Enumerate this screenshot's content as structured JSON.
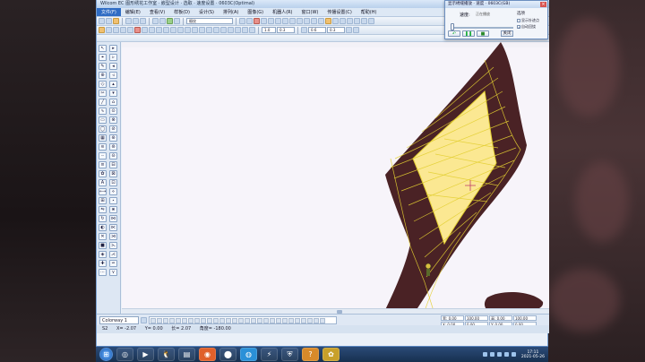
{
  "window": {
    "title": "Wilcom EC 图形绣花工作室 · 嵌型设计 · 选取 · 速度设置 · 0603C(Optimal)"
  },
  "menu": [
    "文件(F)",
    "编辑(E)",
    "查看(V)",
    "样板(D)",
    "设计(S)",
    "排列(A)",
    "图像(G)",
    "机器人(R)",
    "窗口(W)",
    "传播设置(C)",
    "帮助(H)"
  ],
  "toolbar": {
    "stitch_type_select": "缎纹",
    "value_a": "1.0",
    "value_b": "0.3",
    "value_c": "0.6",
    "value_d": "0.3"
  },
  "bottom": {
    "colorway_select": "Colorway 1"
  },
  "coords": {
    "w_label": "宽: 0.00",
    "w_val": "100.00",
    "h_label": "高: 0.00",
    "h_val": "100.00",
    "x_label": "X: 0.00",
    "x_val": "0.00",
    "y_label": "Y: 0.00",
    "y_val": "0.00"
  },
  "status": {
    "stitch": "S2",
    "coord_x": "X= -2.07",
    "coord_y": "Y= 0.00",
    "length": "长= 2.07",
    "angle": "角度= -180.00"
  },
  "dialog": {
    "title": "显示绣缝播放 · 速度 · 0603C(GB)",
    "speed_label": "速度:",
    "speed_value": "正在播放",
    "options_label": "选项",
    "opt_a": "显示针迹点",
    "opt_b": "自动回绕",
    "close_label": "关闭",
    "opt_b_checked": true
  },
  "taskbar": {
    "clock_time": "17:11",
    "clock_date": "2021-05-26"
  },
  "colors": {
    "fabric_dark": "#4a2225",
    "fill_yellow": "#fbe892",
    "stitch_yellow": "#e3cf32"
  }
}
